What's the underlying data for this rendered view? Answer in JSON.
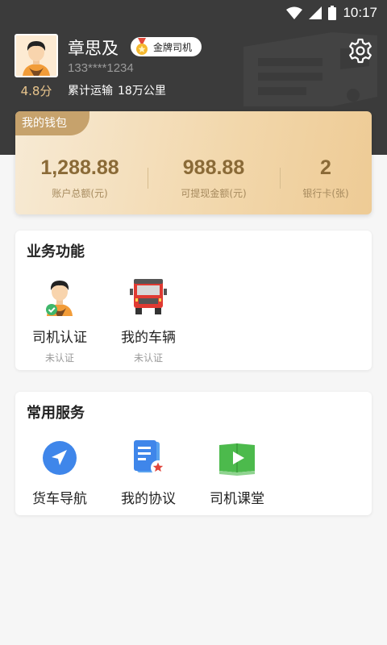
{
  "status_bar": {
    "time": "10:17",
    "icons": [
      "wifi-icon",
      "signal-icon",
      "battery-icon"
    ]
  },
  "profile": {
    "name": "章思及",
    "badge_label": "金牌司机",
    "phone": "133****1234",
    "rating": "4.8分",
    "mileage_label": "累计运输",
    "mileage_value": "18万公里"
  },
  "wallet": {
    "tag": "我的钱包",
    "items": [
      {
        "value": "1,288.88",
        "label": "账户总额(元)"
      },
      {
        "value": "988.88",
        "label": "可提现金额(元)"
      },
      {
        "value": "2",
        "label": "银行卡(张)"
      }
    ]
  },
  "business": {
    "title": "业务功能",
    "items": [
      {
        "label": "司机认证",
        "status": "未认证",
        "icon": "driver-verified-icon"
      },
      {
        "label": "我的车辆",
        "status": "未认证",
        "icon": "truck-icon"
      }
    ]
  },
  "services": {
    "title": "常用服务",
    "items": [
      {
        "label": "货车导航",
        "icon": "navigation-icon"
      },
      {
        "label": "我的协议",
        "icon": "agreement-icon"
      },
      {
        "label": "司机课堂",
        "icon": "classroom-icon"
      }
    ]
  },
  "colors": {
    "header_bg": "#3b3b3b",
    "wallet_gold": "#c6a26c",
    "wallet_value": "#8a6a37",
    "rating": "#e9c58d"
  }
}
